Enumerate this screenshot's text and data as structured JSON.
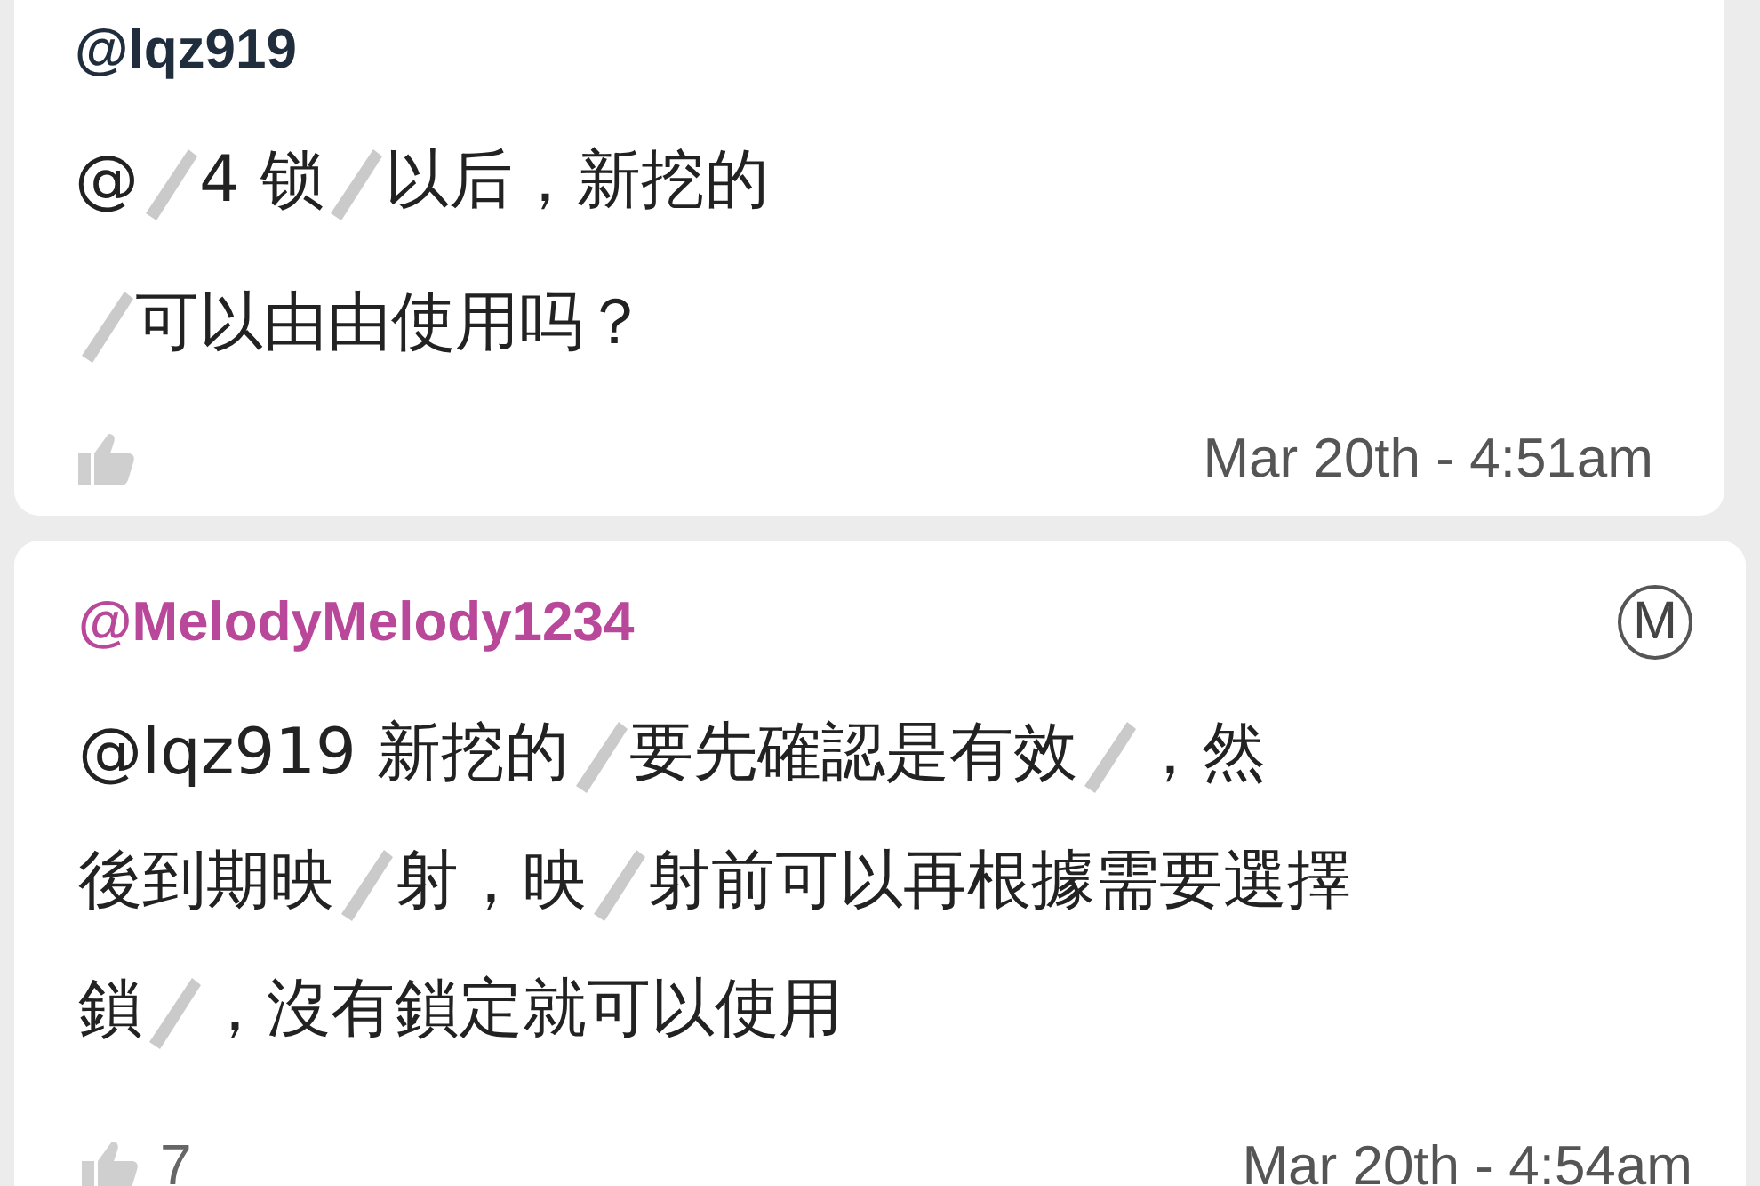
{
  "comments": [
    {
      "username": "@lqz919",
      "lines": [
        [
          {
            "kind": "text",
            "text": "@"
          },
          {
            "kind": "redaction"
          },
          {
            "kind": "text",
            "text": "4 锁"
          },
          {
            "kind": "redaction"
          },
          {
            "kind": "text",
            "text": "以后，新挖的"
          }
        ],
        [
          {
            "kind": "redaction"
          },
          {
            "kind": "text",
            "text": "可以由由使用吗？"
          }
        ]
      ],
      "time": "Mar 20th - 4:51am"
    },
    {
      "username": "@MelodyMelody1234",
      "badge": "M",
      "lines": [
        [
          {
            "kind": "text",
            "text": "@lqz919 新挖的"
          },
          {
            "kind": "redaction"
          },
          {
            "kind": "text",
            "text": "要先確認是有效"
          },
          {
            "kind": "redaction"
          },
          {
            "kind": "text",
            "text": "，然"
          }
        ],
        [
          {
            "kind": "text",
            "text": "後到期映"
          },
          {
            "kind": "redaction"
          },
          {
            "kind": "text",
            "text": "射，映"
          },
          {
            "kind": "redaction"
          },
          {
            "kind": "text",
            "text": "射前可以再根據需要選擇"
          }
        ],
        [
          {
            "kind": "text",
            "text": "鎖"
          },
          {
            "kind": "redaction"
          },
          {
            "kind": "text",
            "text": "，沒有鎖定就可以使用"
          }
        ]
      ],
      "likes": "7",
      "time": "Mar 20th - 4:54am"
    }
  ]
}
